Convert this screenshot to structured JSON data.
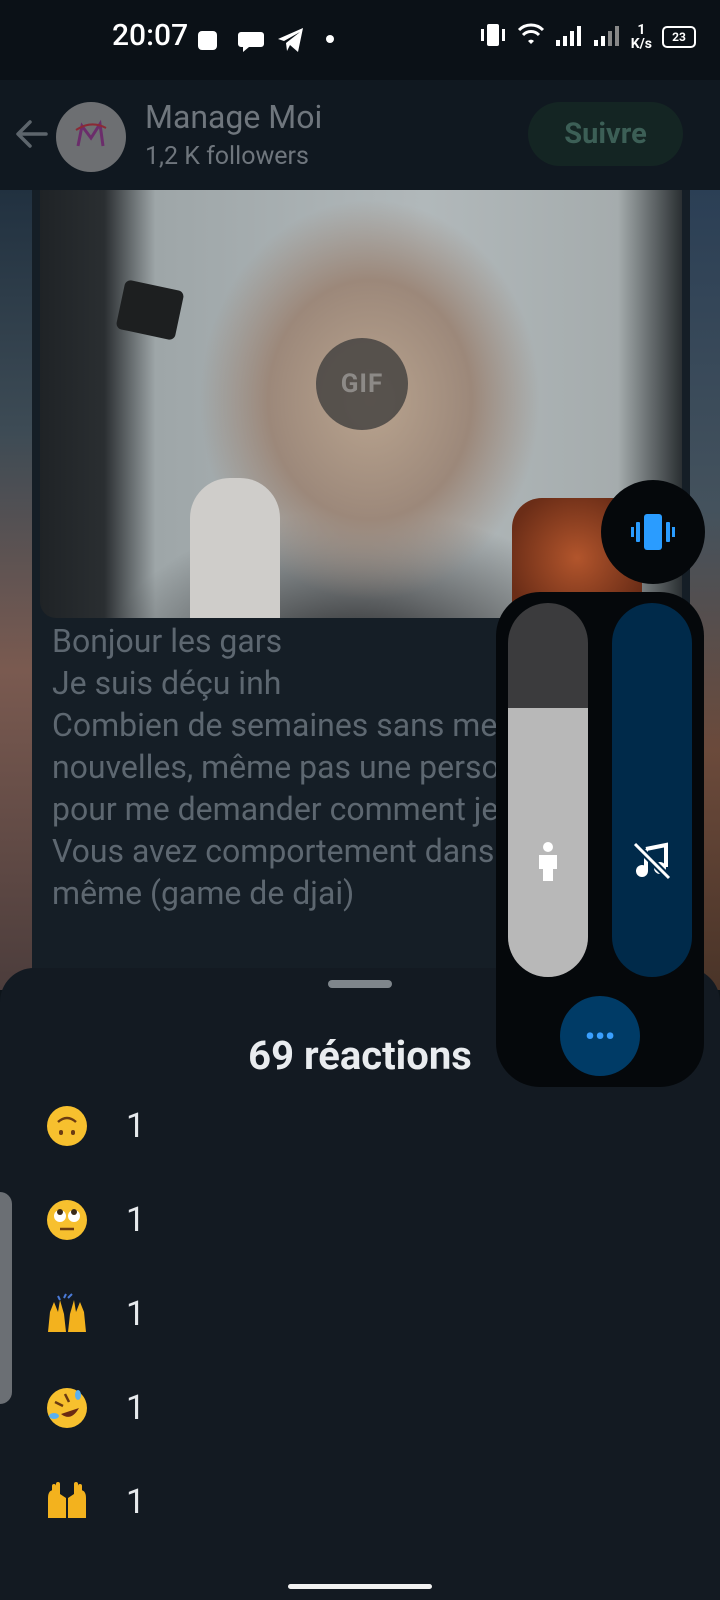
{
  "status_bar": {
    "time": "20:07",
    "net_speed_value": "1",
    "net_speed_unit": "K/s",
    "battery": "23"
  },
  "header": {
    "channel_name": "Manage Moi",
    "followers": "1,2 K followers",
    "follow_label": "Suivre"
  },
  "post": {
    "gif_badge": "GIF",
    "text": "Bonjour les gars\nJe suis déçu inh\nCombien de semaines sans mes\nnouvelles, même pas une personne\npour me demander comment je vais.\nVous avez comportement dans ws\nmême (game de djai)"
  },
  "reactions_sheet": {
    "title": "69 réactions",
    "items": [
      {
        "emoji": "upside-down-face",
        "count": "1"
      },
      {
        "emoji": "face-with-rolling-eyes",
        "count": "1"
      },
      {
        "emoji": "raising-hands",
        "count": "1"
      },
      {
        "emoji": "rolling-on-floor-laughing",
        "count": "1"
      },
      {
        "emoji": "palms-up-together",
        "count": "1"
      }
    ]
  },
  "volume_panel": {
    "media_level": 0.72,
    "ringer_mode": "muted"
  },
  "colors": {
    "accent": "#3aa0ff",
    "sheet_bg": "#131a22",
    "follow_text": "#3c5f56"
  }
}
